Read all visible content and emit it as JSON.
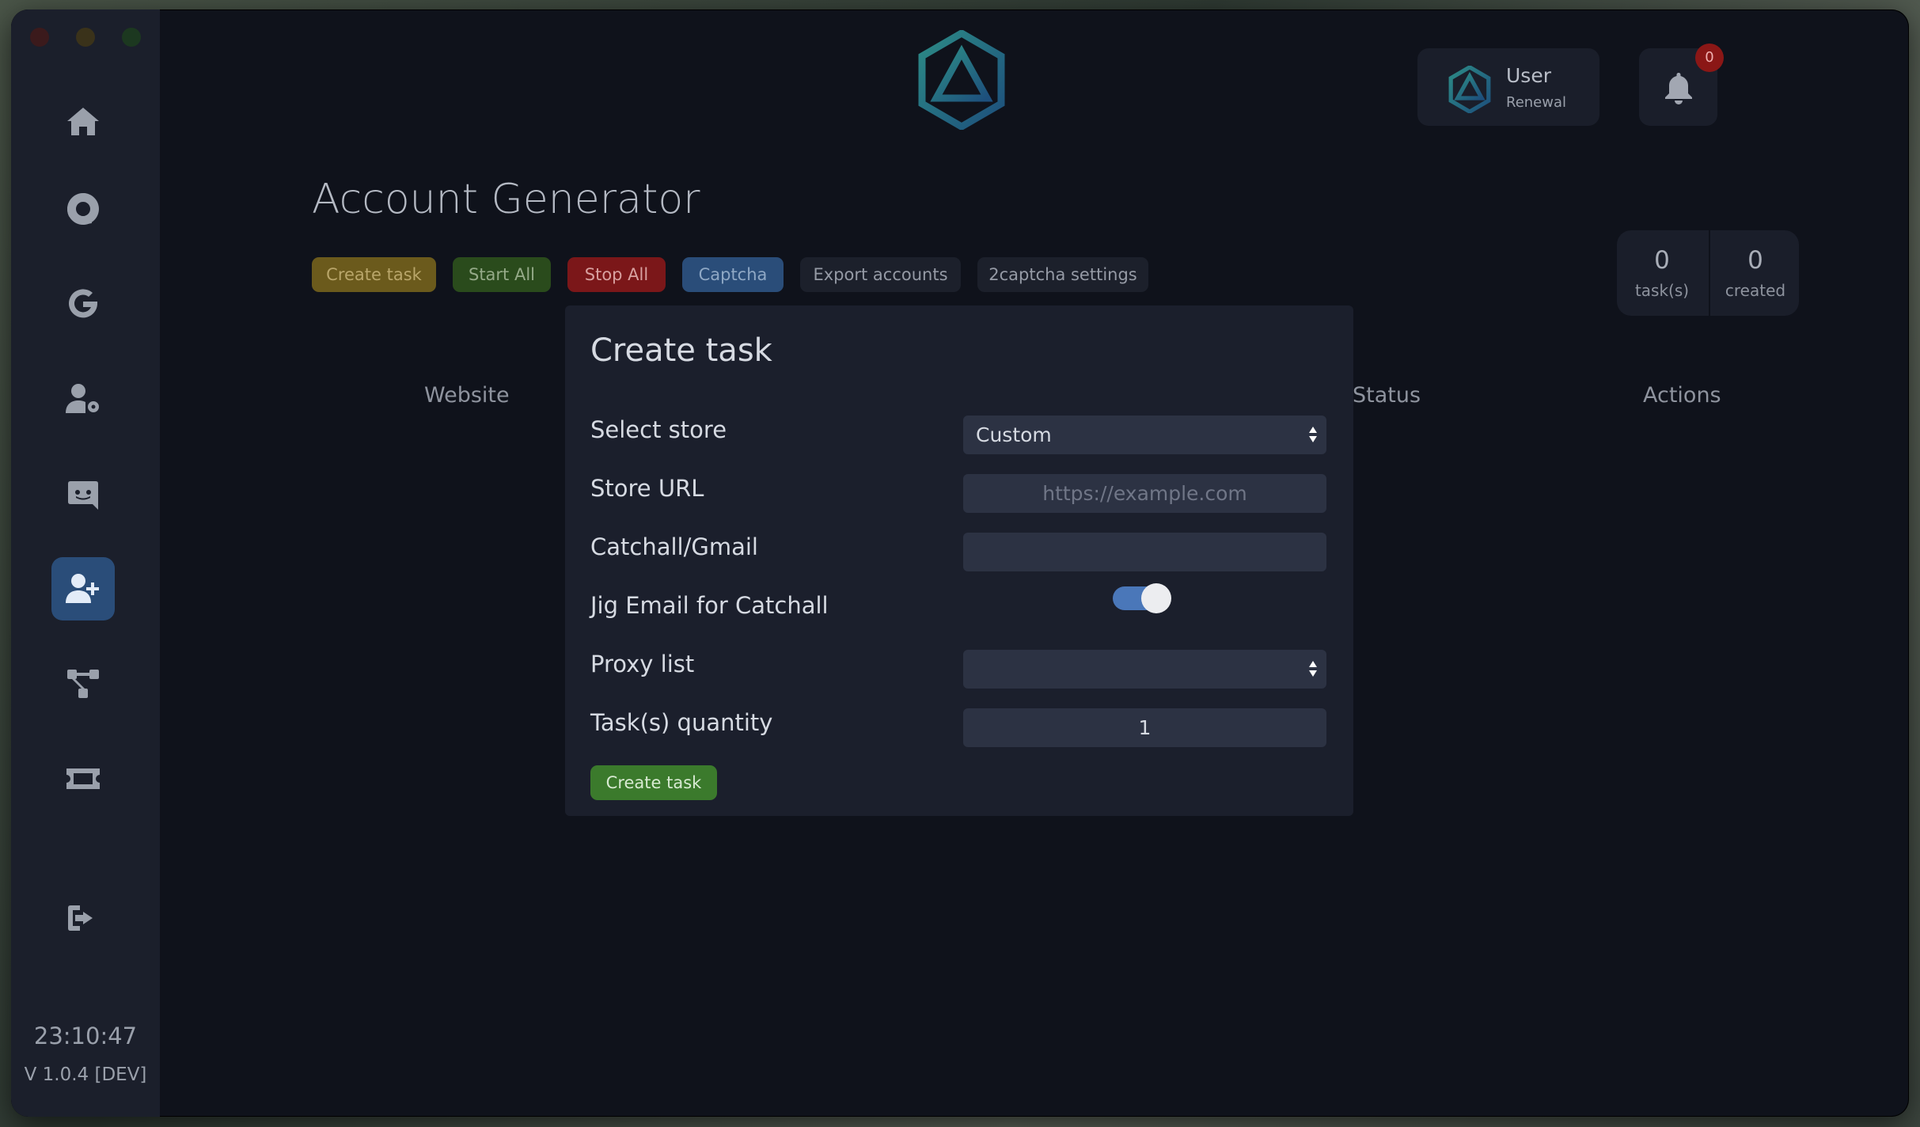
{
  "sidebar": {
    "items": [
      {
        "name": "home-icon"
      },
      {
        "name": "chrome-icon"
      },
      {
        "name": "google-icon"
      },
      {
        "name": "user-settings-icon"
      },
      {
        "name": "discord-icon"
      },
      {
        "name": "user-plus-icon",
        "active": true
      },
      {
        "name": "network-icon"
      },
      {
        "name": "ticket-icon"
      }
    ],
    "logout_icon": "sign-out-icon",
    "clock": "23:10:47",
    "version": "V 1.0.4 [DEV]"
  },
  "header": {
    "user_name": "User",
    "user_plan": "Renewal",
    "notification_count": "0"
  },
  "page": {
    "title": "Account Generator",
    "toolbar": {
      "create_task": "Create task",
      "start_all": "Start All",
      "stop_all": "Stop All",
      "captcha": "Captcha",
      "export_accounts": "Export accounts",
      "captcha_settings": "2captcha settings"
    },
    "stats": {
      "tasks_count": "0",
      "tasks_label": "task(s)",
      "created_count": "0",
      "created_label": "created"
    },
    "table_headers": {
      "website": "Website",
      "status": "Status",
      "actions": "Actions"
    }
  },
  "modal": {
    "title": "Create task",
    "select_store_label": "Select store",
    "select_store_value": "Custom",
    "store_url_label": "Store URL",
    "store_url_placeholder": "https://example.com",
    "catchall_label": "Catchall/Gmail",
    "catchall_value": "",
    "jig_label": "Jig Email for Catchall",
    "jig_enabled": true,
    "proxy_label": "Proxy list",
    "proxy_value": "",
    "quantity_label": "Task(s) quantity",
    "quantity_value": "1",
    "submit_label": "Create task"
  },
  "colors": {
    "accent_blue": "#2a4d79",
    "create_green": "#3b7a2c",
    "stop_red": "#7b1719",
    "create_gold": "#6b5a1c"
  }
}
